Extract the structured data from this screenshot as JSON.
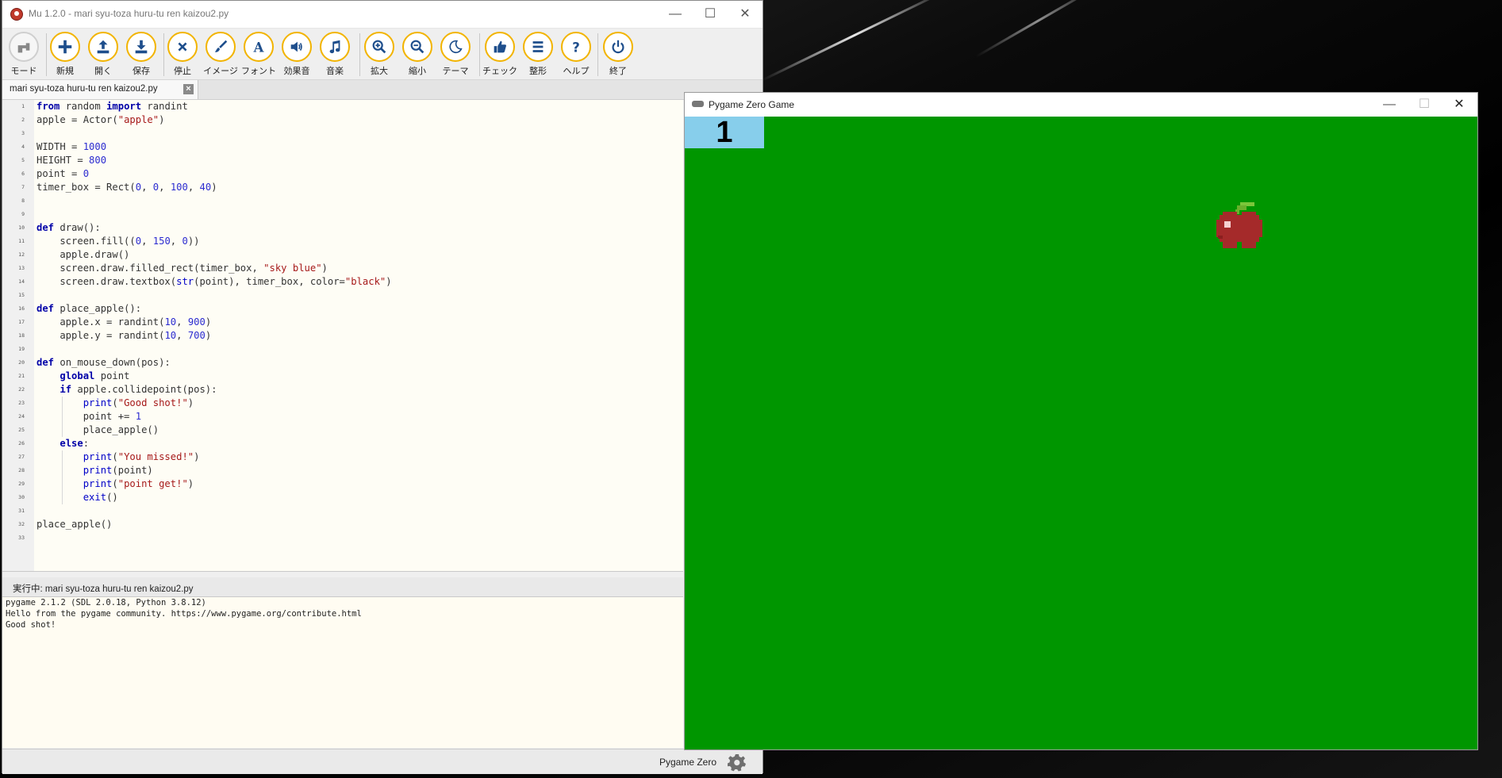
{
  "mu": {
    "title": "Mu 1.2.0 - mari syu-toza huru-tu ren kaizou2.py",
    "toolbar": [
      {
        "label": "モード",
        "icon": "mode-icon"
      },
      {
        "label": "新規",
        "icon": "plus-icon"
      },
      {
        "label": "開く",
        "icon": "upload-icon"
      },
      {
        "label": "保存",
        "icon": "download-icon"
      },
      {
        "label": "停止",
        "icon": "close-x-icon"
      },
      {
        "label": "イメージ",
        "icon": "brush-icon"
      },
      {
        "label": "フォント",
        "icon": "font-icon"
      },
      {
        "label": "効果音",
        "icon": "speaker-icon"
      },
      {
        "label": "音楽",
        "icon": "music-note-icon"
      },
      {
        "label": "拡大",
        "icon": "zoom-in-icon"
      },
      {
        "label": "縮小",
        "icon": "zoom-out-icon"
      },
      {
        "label": "テーマ",
        "icon": "moon-icon"
      },
      {
        "label": "チェック",
        "icon": "thumbs-up-icon"
      },
      {
        "label": "整形",
        "icon": "lines-icon"
      },
      {
        "label": "ヘルプ",
        "icon": "question-icon"
      },
      {
        "label": "終了",
        "icon": "power-icon"
      }
    ],
    "tab": {
      "label": "mari syu-toza huru-tu ren kaizou2.py"
    },
    "running_label": "実行中: mari syu-toza huru-tu ren kaizou2.py",
    "console_lines": [
      "pygame 2.1.2 (SDL 2.0.18, Python 3.8.12)",
      "Hello from the pygame community. https://www.pygame.org/contribute.html",
      "Good shot!"
    ],
    "status_mode": "Pygame Zero"
  },
  "code_lines": [
    "from random import randint",
    "apple = Actor(\"apple\")",
    "",
    "WIDTH = 1000",
    "HEIGHT = 800",
    "point = 0",
    "timer_box = Rect(0, 0, 100, 40)",
    "",
    "",
    "def draw():",
    "    screen.fill((0, 150, 0))",
    "    apple.draw()",
    "    screen.draw.filled_rect(timer_box, \"sky blue\")",
    "    screen.draw.textbox(str(point), timer_box, color=\"black\")",
    "",
    "def place_apple():",
    "    apple.x = randint(10, 900)",
    "    apple.y = randint(10, 700)",
    "",
    "def on_mouse_down(pos):",
    "    global point",
    "    if apple.collidepoint(pos):",
    "        print(\"Good shot!\")",
    "        point += 1",
    "        place_apple()",
    "    else:",
    "        print(\"You missed!\")",
    "        print(point)",
    "        print(\"point get!\")",
    "        exit()",
    "",
    "place_apple()",
    ""
  ],
  "game": {
    "title": "Pygame Zero Game",
    "score": "1",
    "colors": {
      "background": "#009600",
      "timer_box": "#87ceeb",
      "apple": "#a52a2a",
      "leaf": "#7bc63a"
    }
  },
  "window_controls": {
    "minimize": "—",
    "maximize": "☐",
    "close": "✕"
  }
}
